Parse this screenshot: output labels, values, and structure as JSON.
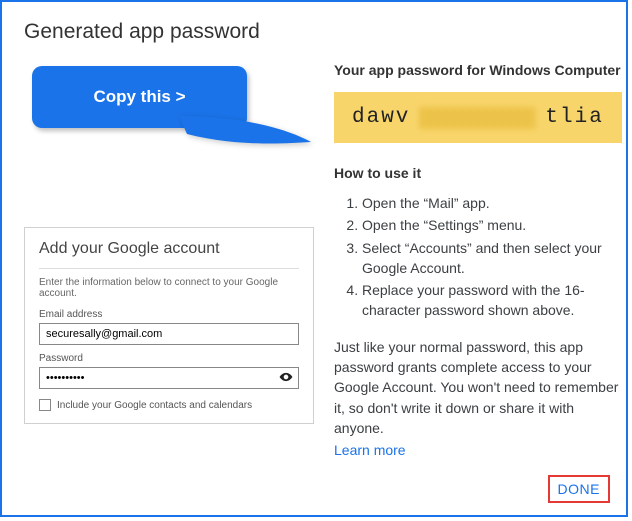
{
  "title": "Generated app password",
  "annotation": {
    "bubble_text": "Copy this >"
  },
  "right": {
    "subhead": "Your app password for Windows Computer",
    "password_visible_prefix": "dawv",
    "password_visible_suffix": "tlia",
    "howto_head": "How to use it",
    "steps": [
      "Open the “Mail” app.",
      "Open the “Settings” menu.",
      "Select “Accounts” and then select your Google Account.",
      "Replace your password with the 16-character password shown above."
    ],
    "disclaimer": "Just like your normal password, this app password grants complete access to your Google Account. You won't need to remember it, so don't write it down or share it with anyone.",
    "learn_more": "Learn more",
    "done_label": "DONE"
  },
  "inset": {
    "title": "Add your Google account",
    "subtitle": "Enter the information below to connect to your Google account.",
    "email_label": "Email address",
    "email_value": "securesally@gmail.com",
    "password_label": "Password",
    "password_value": "••••••••••",
    "checkbox_label": "Include your Google contacts and calendars"
  }
}
